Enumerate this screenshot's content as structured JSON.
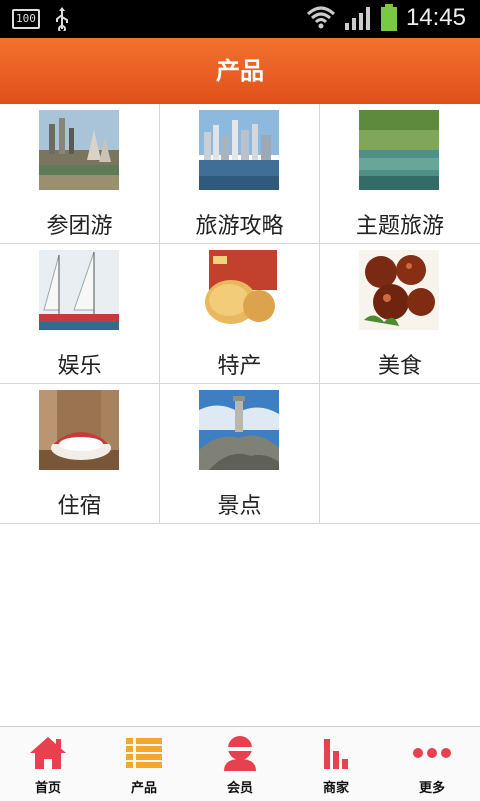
{
  "status_bar": {
    "battery_small": "100",
    "time": "14:45"
  },
  "header": {
    "title": "产品"
  },
  "grid": [
    {
      "label": "参团游",
      "image": "city-waterfront-photo"
    },
    {
      "label": "旅游攻略",
      "image": "city-skyline-photo"
    },
    {
      "label": "主题旅游",
      "image": "lake-scenery-photo"
    },
    {
      "label": "娱乐",
      "image": "sailboats-photo"
    },
    {
      "label": "特产",
      "image": "pastry-specialty-photo"
    },
    {
      "label": "美食",
      "image": "meatballs-dish-photo"
    },
    {
      "label": "住宿",
      "image": "hotel-room-photo"
    },
    {
      "label": "景点",
      "image": "lighthouse-rock-photo"
    }
  ],
  "tabbar": {
    "tabs": [
      {
        "label": "首页",
        "icon": "home-icon"
      },
      {
        "label": "产品",
        "icon": "list-icon"
      },
      {
        "label": "会员",
        "icon": "user-icon"
      },
      {
        "label": "商家",
        "icon": "bar-chart-icon"
      },
      {
        "label": "更多",
        "icon": "more-icon"
      }
    ]
  },
  "colors": {
    "header": "#e85a1f",
    "tab_icon_red": "#e8404e",
    "tab_icon_orange": "#f0a830"
  }
}
